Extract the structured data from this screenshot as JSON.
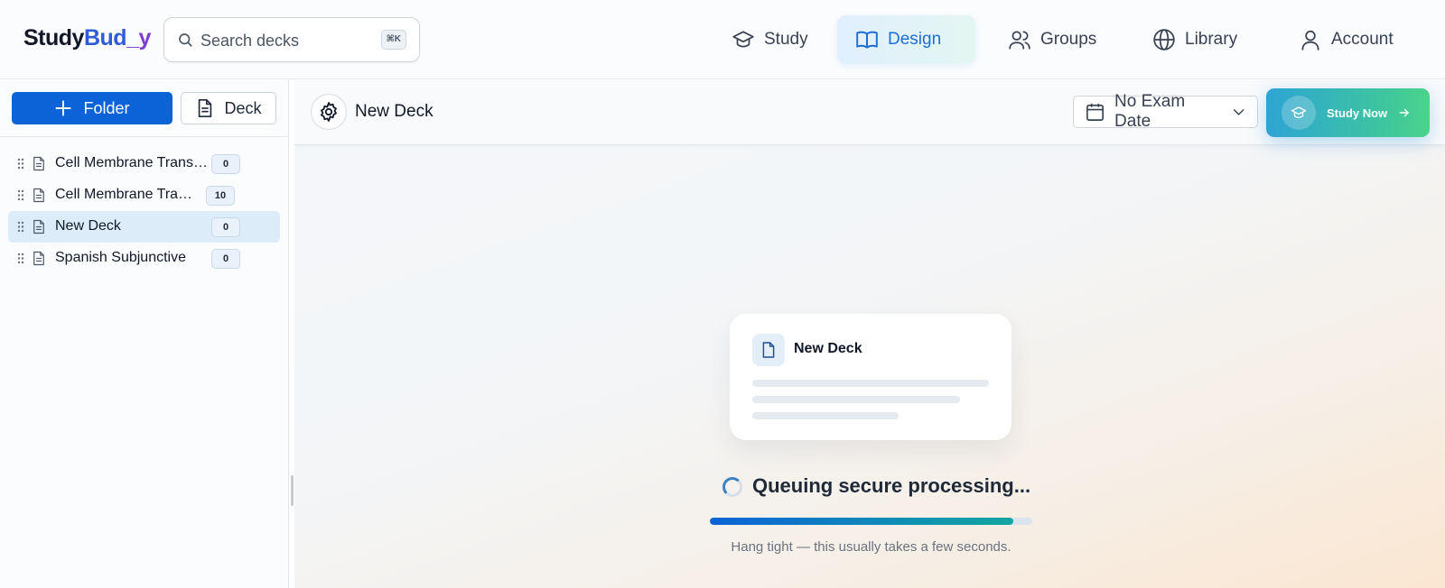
{
  "app": {
    "logo": {
      "part1": "Study",
      "part2": "Bud",
      "part3": "_y"
    },
    "search": {
      "placeholder": "Search decks",
      "shortcut": "⌘K"
    }
  },
  "nav": {
    "items": [
      {
        "label": "Study",
        "icon": "graduation-cap-icon",
        "active": false
      },
      {
        "label": "Design",
        "icon": "open-book-icon",
        "active": true
      },
      {
        "label": "Groups",
        "icon": "users-icon",
        "active": false
      },
      {
        "label": "Library",
        "icon": "globe-icon",
        "active": false
      },
      {
        "label": "Account",
        "icon": "user-icon",
        "active": false
      }
    ]
  },
  "sidebar": {
    "new_folder_label": "Folder",
    "new_deck_label": "Deck",
    "decks": [
      {
        "name": "Cell Membrane Transport",
        "count": "0",
        "selected": false
      },
      {
        "name": "Cell Membrane Transport",
        "count": "10",
        "selected": false
      },
      {
        "name": "New Deck",
        "count": "0",
        "selected": true
      },
      {
        "name": "Spanish Subjunctive",
        "count": "0",
        "selected": false
      }
    ]
  },
  "main": {
    "deck_title": "New Deck",
    "exam_date_label": "No Exam Date",
    "study_now_label": "Study Now",
    "card_title": "New Deck",
    "status": "Queuing secure processing...",
    "progress": 0.94,
    "hint": "Hang tight — this usually takes a few seconds."
  },
  "colors": {
    "primary": "#0b63d7",
    "active_nav_text": "#1d6fd6",
    "selected_row": "#dcedf9",
    "study_gradient_start": "#2ea4d5",
    "study_gradient_end": "#4bd38a"
  }
}
